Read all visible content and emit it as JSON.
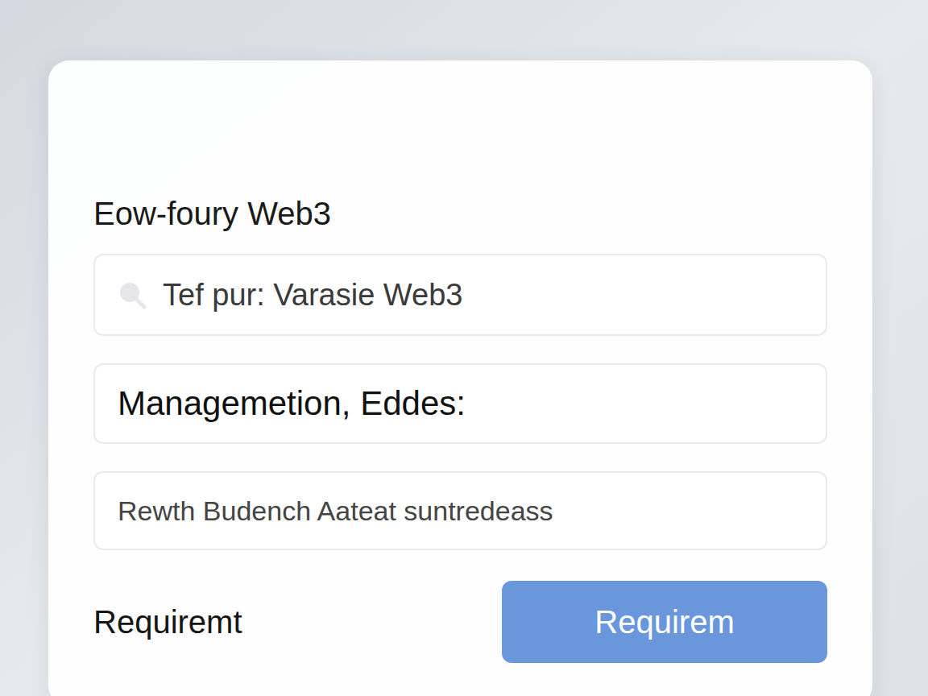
{
  "card": {
    "title": "Eow-foury Web3",
    "fields": [
      {
        "kind": "search",
        "text": "Tef pur: Varasie Web3"
      },
      {
        "kind": "label",
        "text": "Managemetion, Eddes:"
      },
      {
        "kind": "text",
        "text": "Rewth Budench Aateat suntredeass"
      }
    ],
    "footer": {
      "label": "Requiremt",
      "button": "Requirem"
    }
  }
}
